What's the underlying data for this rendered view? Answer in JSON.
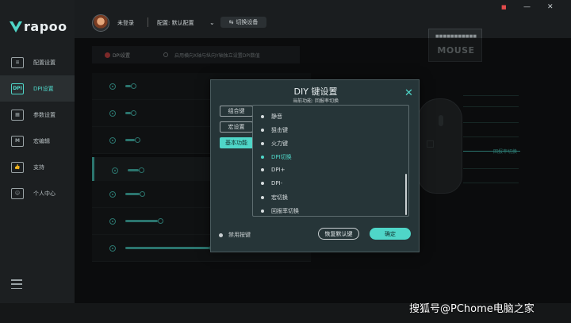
{
  "brand": {
    "logo_text": "rapoo"
  },
  "sidebar": {
    "items": [
      {
        "label": "配置设置",
        "icon": "config-icon",
        "glyph": "≡"
      },
      {
        "label": "DPI设置",
        "icon": "dpi-icon",
        "glyph": "DPI",
        "active": true
      },
      {
        "label": "参数设置",
        "icon": "params-icon",
        "glyph": "▦"
      },
      {
        "label": "宏编辑",
        "icon": "macro-icon",
        "glyph": "M"
      },
      {
        "label": "支持",
        "icon": "thumbs-up-icon",
        "glyph": "👍"
      },
      {
        "label": "个人中心",
        "icon": "user-icon",
        "glyph": "☺"
      }
    ]
  },
  "topbar": {
    "user": "未登录",
    "profile": "配置: 默认配置",
    "switch_device": "切换设备",
    "window_controls": {
      "min": "—",
      "close": "✕"
    },
    "device_brand": "MOUSE"
  },
  "dpi_panel": {
    "header_label": "DPI设置",
    "option_label": "启用横向X轴与纵向Y轴独立设置DPI数值",
    "rows": [
      {
        "level": 0.03
      },
      {
        "level": 0.03
      },
      {
        "level": 0.05
      },
      {
        "level": 0.06,
        "selected": true
      },
      {
        "level": 0.08
      },
      {
        "level": 0.18
      },
      {
        "level": 0.46
      }
    ]
  },
  "mouse_callouts": {
    "labels": [
      "",
      "",
      "",
      "",
      "回报率切换",
      "",
      ""
    ],
    "highlighted_index": 4
  },
  "dialog": {
    "title": "DIY 键设置",
    "subtitle": "当前功能: 回报率切换",
    "close": "✕",
    "tabs": [
      {
        "label": "组合键"
      },
      {
        "label": "宏设置"
      },
      {
        "label": "基本功能",
        "active": true
      }
    ],
    "functions": [
      {
        "label": "静音"
      },
      {
        "label": "狙击键"
      },
      {
        "label": "火力键"
      },
      {
        "label": "DPI切换",
        "active": true
      },
      {
        "label": "DPI+"
      },
      {
        "label": "DPI-"
      },
      {
        "label": "宏切换"
      },
      {
        "label": "回报率切换"
      }
    ],
    "disable_key": "禁用按键",
    "restore_default": "恢复默认键",
    "confirm": "确定"
  },
  "watermark": "搜狐号@PChome电脑之家",
  "colors": {
    "accent": "#4fd6c8",
    "record": "#e24b4b",
    "bg": "#151718",
    "dialog_bg": "#263538"
  }
}
